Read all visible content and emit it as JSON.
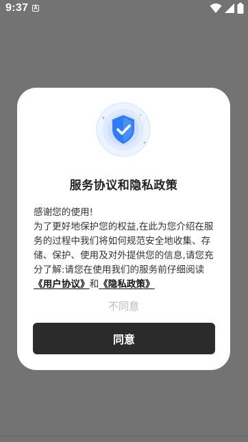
{
  "status_bar": {
    "time": "9:37",
    "notification_icon": "A",
    "icons": [
      "wifi-icon",
      "cellular-signal-icon",
      "battery-icon"
    ]
  },
  "dialog": {
    "badge_icon": "shield-check-icon",
    "title": "服务协议和隐私政策",
    "greeting": "感谢您的使用!",
    "body_text": "为了更好地保护您的权益,在此为您介绍在服务的过程中我们将如何规范安全地收集、存储、保护、使用及对外提供您的信息,请您充分了解:请您在使用我们的服务前仔细阅读",
    "user_agreement_link": "《用户协议》",
    "conjunction": "和",
    "privacy_policy_link": "《隐私政策》",
    "disagree_label": "不同意",
    "agree_label": "同意"
  },
  "colors": {
    "overlay": "#737373",
    "dialog_bg": "#ffffff",
    "agree_button": "#2b2b2b",
    "badge_blue": "#2f7cf6",
    "disagree_text": "#b8b8b8"
  }
}
